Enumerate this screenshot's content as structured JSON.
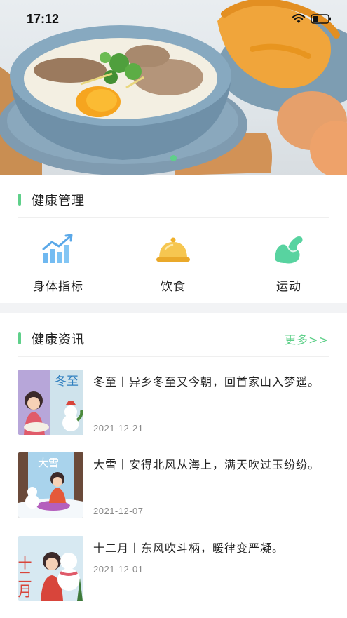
{
  "status_bar": {
    "time": "17:12"
  },
  "banner": {
    "image": "congee-breakfast-photo",
    "active_page": 1,
    "page_count": 1
  },
  "health_management": {
    "title": "健康管理",
    "items": [
      {
        "label": "身体指标",
        "icon": "bar-chart-trend-icon",
        "color": "#6fb8f0"
      },
      {
        "label": "饮食",
        "icon": "food-cloche-icon",
        "color": "#f3bd3d"
      },
      {
        "label": "运动",
        "icon": "flexed-arm-icon",
        "color": "#58d3a0"
      }
    ]
  },
  "health_news": {
    "title": "健康资讯",
    "more": "更多>>",
    "items": [
      {
        "title": "冬至丨异乡冬至又今朝，回首家山入梦遥。",
        "date": "2021-12-21",
        "thumb_text": "冬至"
      },
      {
        "title": "大雪丨安得北风从海上，满天吹过玉纷纷。",
        "date": "2021-12-07",
        "thumb_text": "大雪"
      },
      {
        "title": "十二月丨东风吹斗柄，暖律变严凝。",
        "date": "2021-12-01",
        "thumb_text": "十二月"
      }
    ]
  },
  "colors": {
    "accent": "#5fd08a",
    "divider": "#f2f3f5"
  }
}
